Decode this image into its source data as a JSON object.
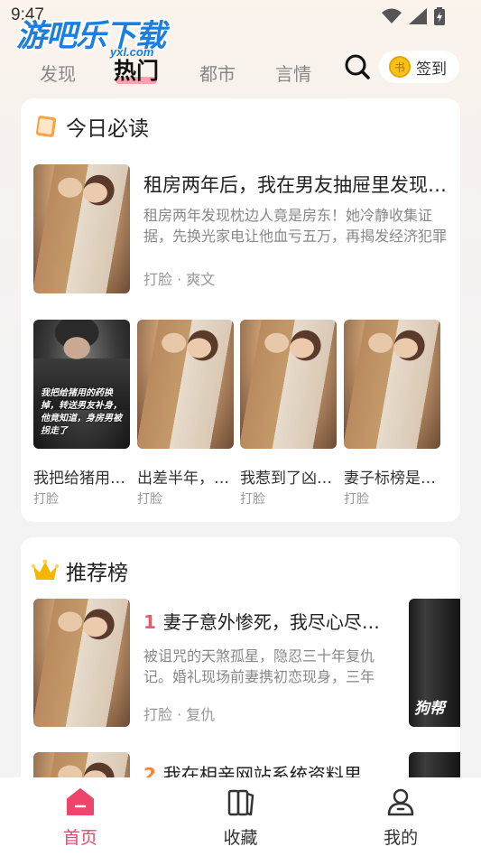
{
  "status_bar": {
    "time": "9:47"
  },
  "watermark": {
    "text": "游吧乐下载",
    "sub": "yxl.com"
  },
  "tabs": [
    {
      "label": "发现",
      "active": false
    },
    {
      "label": "热门",
      "active": true
    },
    {
      "label": "都市",
      "active": false
    },
    {
      "label": "言情",
      "active": false
    }
  ],
  "header": {
    "signin_label": "签到",
    "coin_glyph": "书"
  },
  "daily": {
    "title": "今日必读",
    "featured": {
      "title": "租房两年后，我在男友抽屉里发现了房产证",
      "desc": "租房两年发现枕边人竟是房东！她冷静收集证据，先换光家电让他血亏五万，再揭发经济犯罪",
      "tags": "打脸 · 爽文"
    },
    "books": [
      {
        "title": "我把给猪用的药换进了男友杯子",
        "tag": "打脸",
        "cover_caption": "我把给猪用的药换掉，转送男友补身，他竟知道，身房男被拐走了"
      },
      {
        "title": "出差半年，回来发现家里多了个人",
        "tag": "打脸"
      },
      {
        "title": "我惹到了凶神恶煞的大佬",
        "tag": "打脸"
      },
      {
        "title": "妻子标榜是独立女性",
        "tag": "打脸"
      }
    ]
  },
  "ranking": {
    "title": "推荐榜",
    "items": [
      {
        "rank": "1",
        "title": "妻子意外惨死，我尽心尽力办完丧事",
        "desc": "被诅咒的天煞孤星，隐忍三十年复仇记。婚礼现场前妻携初恋现身，三年的",
        "tags": "打脸 · 复仇",
        "side_cover_text": "狗帮"
      },
      {
        "rank": "2",
        "title": "我在相亲网站系统资料里发现了秘密"
      }
    ]
  },
  "bottom_nav": [
    {
      "label": "首页",
      "active": true
    },
    {
      "label": "收藏",
      "active": false
    },
    {
      "label": "我的",
      "active": false
    }
  ],
  "colors": {
    "accent": "#f0456a",
    "rank1": "#f0576c",
    "rank2": "#f5862b",
    "coin": "#f6c21a"
  }
}
